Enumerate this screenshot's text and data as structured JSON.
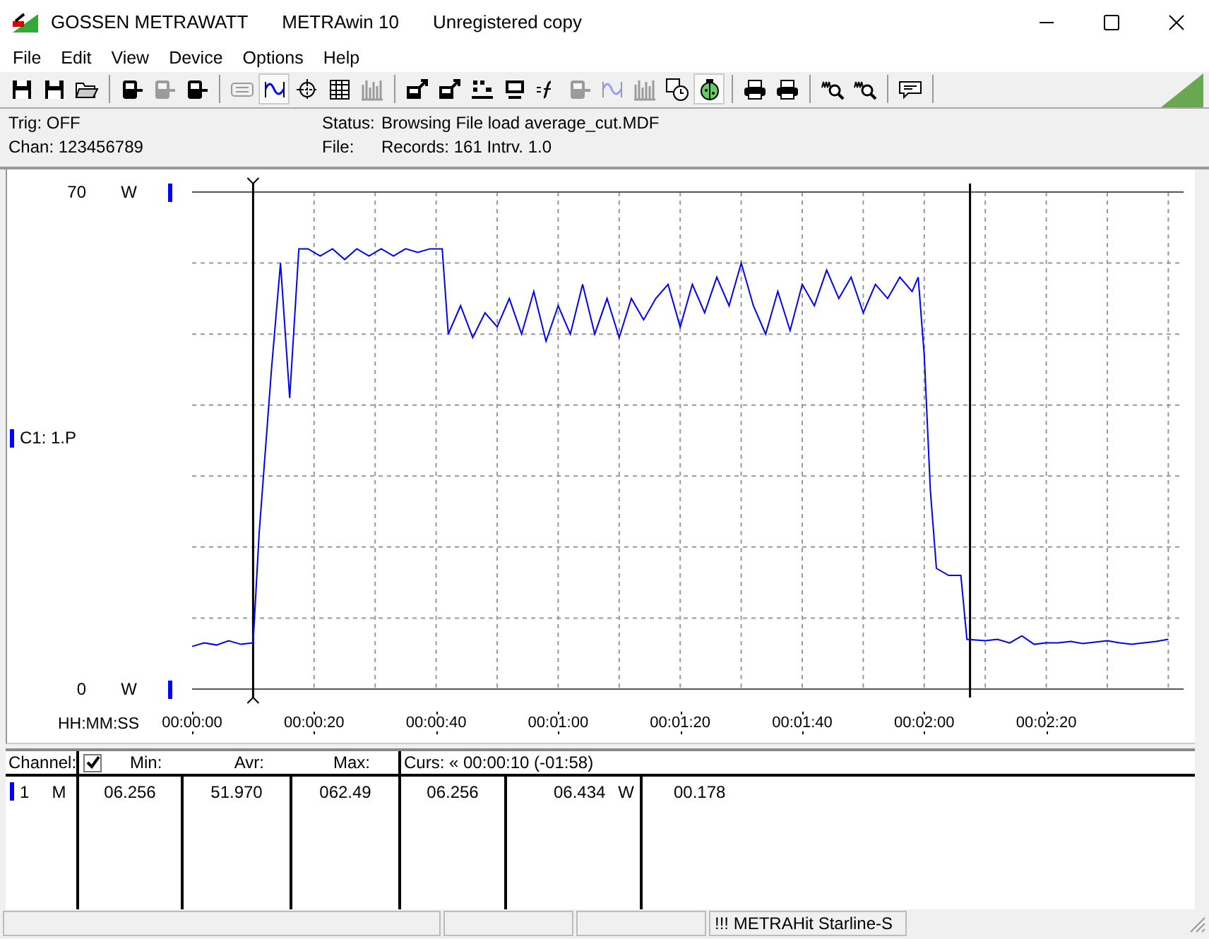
{
  "window": {
    "title_parts": [
      "GOSSEN METRAWATT",
      "METRAwin 10",
      "Unregistered copy"
    ]
  },
  "menu": [
    "File",
    "Edit",
    "View",
    "Device",
    "Options",
    "Help"
  ],
  "toolbar": [
    {
      "kind": "save",
      "pressed": false,
      "disabled": false
    },
    {
      "kind": "save",
      "pressed": false,
      "disabled": false
    },
    {
      "kind": "open",
      "pressed": false,
      "disabled": false
    },
    {
      "kind": "sep"
    },
    {
      "kind": "meter",
      "pressed": false,
      "disabled": false
    },
    {
      "kind": "meter",
      "pressed": false,
      "disabled": true
    },
    {
      "kind": "meter",
      "pressed": false,
      "disabled": false
    },
    {
      "kind": "sep"
    },
    {
      "kind": "display",
      "pressed": false,
      "disabled": true
    },
    {
      "kind": "wave",
      "pressed": true,
      "disabled": false
    },
    {
      "kind": "crosshair",
      "pressed": false,
      "disabled": false
    },
    {
      "kind": "table",
      "pressed": false,
      "disabled": false
    },
    {
      "kind": "bars",
      "pressed": false,
      "disabled": true
    },
    {
      "kind": "sep"
    },
    {
      "kind": "export",
      "pressed": false,
      "disabled": false
    },
    {
      "kind": "export",
      "pressed": false,
      "disabled": false
    },
    {
      "kind": "dataline",
      "pressed": false,
      "disabled": false
    },
    {
      "kind": "monitor",
      "pressed": false,
      "disabled": false
    },
    {
      "kind": "function",
      "pressed": false,
      "disabled": false
    },
    {
      "kind": "meter",
      "pressed": false,
      "disabled": true
    },
    {
      "kind": "wave",
      "pressed": false,
      "disabled": true
    },
    {
      "kind": "bars",
      "pressed": false,
      "disabled": true
    },
    {
      "kind": "clock",
      "pressed": false,
      "disabled": false
    },
    {
      "kind": "bug",
      "pressed": true,
      "disabled": false
    },
    {
      "kind": "sep"
    },
    {
      "kind": "printer",
      "pressed": false,
      "disabled": false
    },
    {
      "kind": "printer",
      "pressed": false,
      "disabled": false
    },
    {
      "kind": "sep"
    },
    {
      "kind": "zoom",
      "pressed": false,
      "disabled": false
    },
    {
      "kind": "zoom",
      "pressed": false,
      "disabled": false
    },
    {
      "kind": "sep"
    },
    {
      "kind": "speech",
      "pressed": false,
      "disabled": false
    },
    {
      "kind": "sep"
    }
  ],
  "info": {
    "trig": "Trig: OFF",
    "chan": "Chan:  123456789",
    "status_label": "Status:",
    "status": "Browsing File load average_cut.MDF",
    "file_label": "File:",
    "file": "Records: 161   Intrv. 1.0"
  },
  "axis": {
    "time_label": "HH:MM:SS"
  },
  "chart": {
    "chart_data": {
      "type": "line",
      "ylabel": "W",
      "xlim": [
        0,
        162.5
      ],
      "ylim": [
        0,
        70
      ],
      "yticks": [
        {
          "value": 0,
          "label": "0"
        },
        {
          "value": 70,
          "label": "70"
        }
      ],
      "xticks": [
        {
          "value": 0,
          "label": "00:00:00"
        },
        {
          "value": 20,
          "label": "00:00:20"
        },
        {
          "value": 40,
          "label": "00:00:40"
        },
        {
          "value": 60,
          "label": "00:01:00"
        },
        {
          "value": 80,
          "label": "00:01:20"
        },
        {
          "value": 100,
          "label": "00:01:40"
        },
        {
          "value": 120,
          "label": "00:02:00"
        },
        {
          "value": 140,
          "label": "00:02:20"
        }
      ],
      "grid": true,
      "ref_lines": [
        {
          "axis": "x",
          "value": 10
        },
        {
          "axis": "x",
          "value": 127.5
        }
      ],
      "x": [
        0,
        2,
        4,
        6,
        8,
        10,
        11,
        13,
        14.5,
        16,
        17.5,
        19,
        21,
        23,
        25,
        27,
        29,
        31,
        33,
        35,
        37,
        39,
        41,
        42,
        44,
        46,
        48,
        50,
        52,
        54,
        56,
        58,
        60,
        62,
        64,
        66,
        68,
        70,
        72,
        74,
        76,
        78,
        80,
        82,
        84,
        86,
        88,
        90,
        92,
        94,
        96,
        98,
        100,
        102,
        104,
        106,
        108,
        110,
        112,
        114,
        116,
        118,
        119,
        120,
        121,
        122,
        124,
        126,
        127,
        130,
        132,
        134,
        136,
        138,
        140,
        142,
        144,
        146,
        148,
        150,
        152,
        154,
        156,
        158,
        160
      ],
      "series": [
        {
          "name": "C1: 1.P",
          "color": "#0000ff",
          "values": [
            6.0,
            6.5,
            6.2,
            6.8,
            6.3,
            6.5,
            22,
            45,
            60,
            41,
            62,
            62,
            61,
            62,
            60.5,
            62,
            61,
            62,
            61,
            62,
            61.5,
            62,
            62,
            50,
            54,
            49.5,
            53,
            51,
            55,
            50,
            56,
            49,
            54,
            50,
            57,
            50,
            55,
            49.5,
            55,
            52,
            55,
            57,
            51,
            57,
            53,
            58,
            54,
            60,
            54,
            50,
            56,
            50.5,
            57,
            54,
            59,
            55,
            58,
            53,
            57,
            55,
            58,
            56,
            58,
            47,
            28,
            17,
            16,
            16,
            7,
            6.8,
            7,
            6.5,
            7.5,
            6.3,
            6.5,
            6.5,
            6.7,
            6.4,
            6.6,
            6.8,
            6.5,
            6.3,
            6.5,
            6.7,
            7
          ]
        }
      ]
    }
  },
  "table": {
    "header": {
      "channel": "Channel:",
      "checked": true,
      "min": "Min:",
      "avr": "Avr:",
      "max": "Max:",
      "curs": "Curs: « 00:00:10 (-01:58)"
    },
    "row": {
      "channel": "1",
      "mode": "M",
      "color": "#0000ff",
      "min": "06.256",
      "avr": "51.970",
      "max": "062.49",
      "curs1": "06.256",
      "curs2": "06.434",
      "unit": "W",
      "diff": "00.178"
    }
  },
  "status_bar": {
    "text": "!!! METRAHit Starline-S"
  }
}
